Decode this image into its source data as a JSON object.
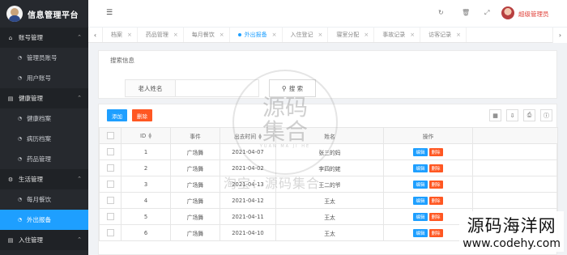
{
  "app": {
    "title": "信息管理平台"
  },
  "sidebar": {
    "groups": [
      {
        "label": "账号管理",
        "icon": "home-icon",
        "items": [
          {
            "label": "管理员账号"
          },
          {
            "label": "用户账号"
          }
        ]
      },
      {
        "label": "健康管理",
        "icon": "document-icon",
        "items": [
          {
            "label": "健康档案"
          },
          {
            "label": "病历档案"
          },
          {
            "label": "药品管理"
          }
        ]
      },
      {
        "label": "生活管理",
        "icon": "gears-icon",
        "items": [
          {
            "label": "每月餐饮"
          },
          {
            "label": "外出报备"
          }
        ]
      },
      {
        "label": "入住管理",
        "icon": "document-icon",
        "items": []
      }
    ]
  },
  "header": {
    "user_name": "超级管理员"
  },
  "tabs": [
    {
      "label": "档案"
    },
    {
      "label": "药品管理"
    },
    {
      "label": "每月餐饮"
    },
    {
      "label": "外出报备"
    },
    {
      "label": "入住登记"
    },
    {
      "label": "寝室分配"
    },
    {
      "label": "事故记录"
    },
    {
      "label": "访客记录"
    }
  ],
  "search": {
    "legend": "搜索信息",
    "field_label": "老人姓名",
    "button_label": "搜 索"
  },
  "toolbar": {
    "add_label": "添加",
    "delete_label": "删除"
  },
  "table": {
    "columns": [
      "ID",
      "事件",
      "出去时间",
      "姓名",
      "操作"
    ],
    "row_actions": {
      "edit": "编辑",
      "delete": "删除"
    },
    "rows": [
      {
        "id": "1",
        "event": "广场舞",
        "time": "2021-04-07",
        "name": "张三的妈"
      },
      {
        "id": "2",
        "event": "广场舞",
        "time": "2021-04-02",
        "name": "李四的姥"
      },
      {
        "id": "3",
        "event": "广场舞",
        "time": "2021-04-13",
        "name": "王二的爷"
      },
      {
        "id": "4",
        "event": "广场舞",
        "time": "2021-04-12",
        "name": "王太"
      },
      {
        "id": "5",
        "event": "广场舞",
        "time": "2021-04-11",
        "name": "王太"
      },
      {
        "id": "6",
        "event": "广场舞",
        "time": "2021-04-10",
        "name": "王太"
      }
    ]
  },
  "watermark": {
    "circle_big": "源码",
    "circle_big2": "集合",
    "circle_sub": "YUAN MA JI HE",
    "middle": "淘宝：源码集合",
    "corner_line1": "源码海洋网",
    "corner_line2": "www.codehy.com"
  }
}
